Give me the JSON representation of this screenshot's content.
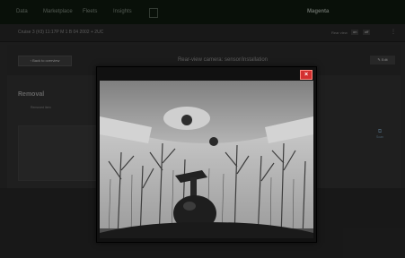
{
  "nav": {
    "items": [
      "Data",
      "Marketplace",
      "Fleets",
      "Insights"
    ],
    "active_button": "",
    "brand": "Magenta",
    "sign_in": ""
  },
  "subbar": {
    "vehicle_text": "Cruise 3 (#3) 11:17P M 1 B 04 2002 + 2UC",
    "right_label": "Rear view",
    "toggle_a": "on",
    "toggle_b": "off"
  },
  "panel": {
    "back_label": "‹ Back to overview",
    "title": "Rear-view camera: sensor/installation",
    "edit_label": "✎ Edit",
    "section_title": "Removal",
    "subsection_label": "Removed item",
    "side_action_label": "Scan"
  },
  "modal": {
    "close_label": "×"
  },
  "colors": {
    "close_button": "#d32f2f",
    "nav_background": "#0f1a0f",
    "page_background": "#2b2b2b"
  },
  "icons": {
    "close": "close-icon",
    "side_action": "scan-icon"
  }
}
